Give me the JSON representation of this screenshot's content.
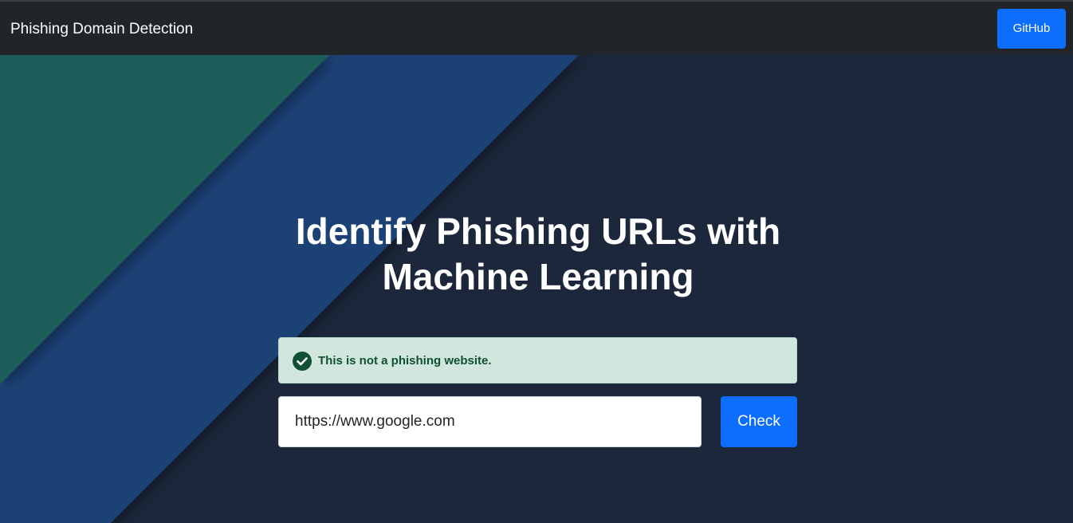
{
  "navbar": {
    "brand": "Phishing Domain Detection",
    "github_label": "GitHub",
    "background": "#212529"
  },
  "hero": {
    "headline": "Identify Phishing URLs with Machine Learning",
    "background": "#1c273b",
    "stripe_colors": [
      "#1f5e5a",
      "#1d4274"
    ]
  },
  "alert": {
    "message": "This is not a phishing website.",
    "icon": "check-circle-icon",
    "background": "#d1e7dd",
    "text_color": "#0f5132"
  },
  "form": {
    "url_value": "https://www.google.com",
    "check_label": "Check",
    "button_color": "#0d6efd"
  }
}
